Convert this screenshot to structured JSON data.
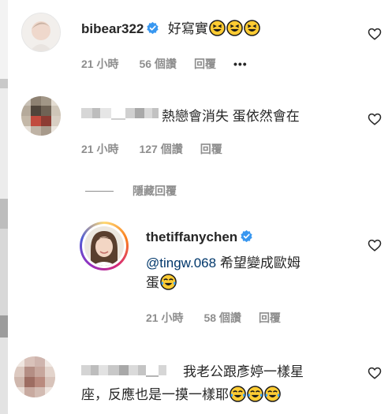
{
  "comments": [
    {
      "username": "bibear322",
      "text": "好寫實",
      "emoji_count": 3,
      "time": "21 小時",
      "likes": "56 個讚",
      "reply": "回覆",
      "more": "•••"
    },
    {
      "text": "熱戀會消失 蛋依然會在",
      "time": "21 小時",
      "likes": "127 個讚",
      "reply": "回覆",
      "hide_replies": "隱藏回覆"
    },
    {
      "username": "thetiffanychen",
      "mention": "@tingw.068",
      "text_line1": " 希望變成歐姆",
      "text_line2": "蛋",
      "emoji_count": 1,
      "time": "21 小時",
      "likes": "58 個讚",
      "reply": "回覆"
    },
    {
      "text_line1": "我老公跟彥婷一樣星",
      "text_line2": "座，反應也是一摸一樣耶",
      "emoji_count": 3
    }
  ],
  "icons": {
    "heart": "heart-outline-icon",
    "verified": "verified-badge-icon",
    "emoji": "tears-of-joy-emoji-icon"
  },
  "colors": {
    "text": "#262626",
    "meta": "#8e8e8e",
    "link": "#00376b",
    "verified": "#3897f0"
  }
}
